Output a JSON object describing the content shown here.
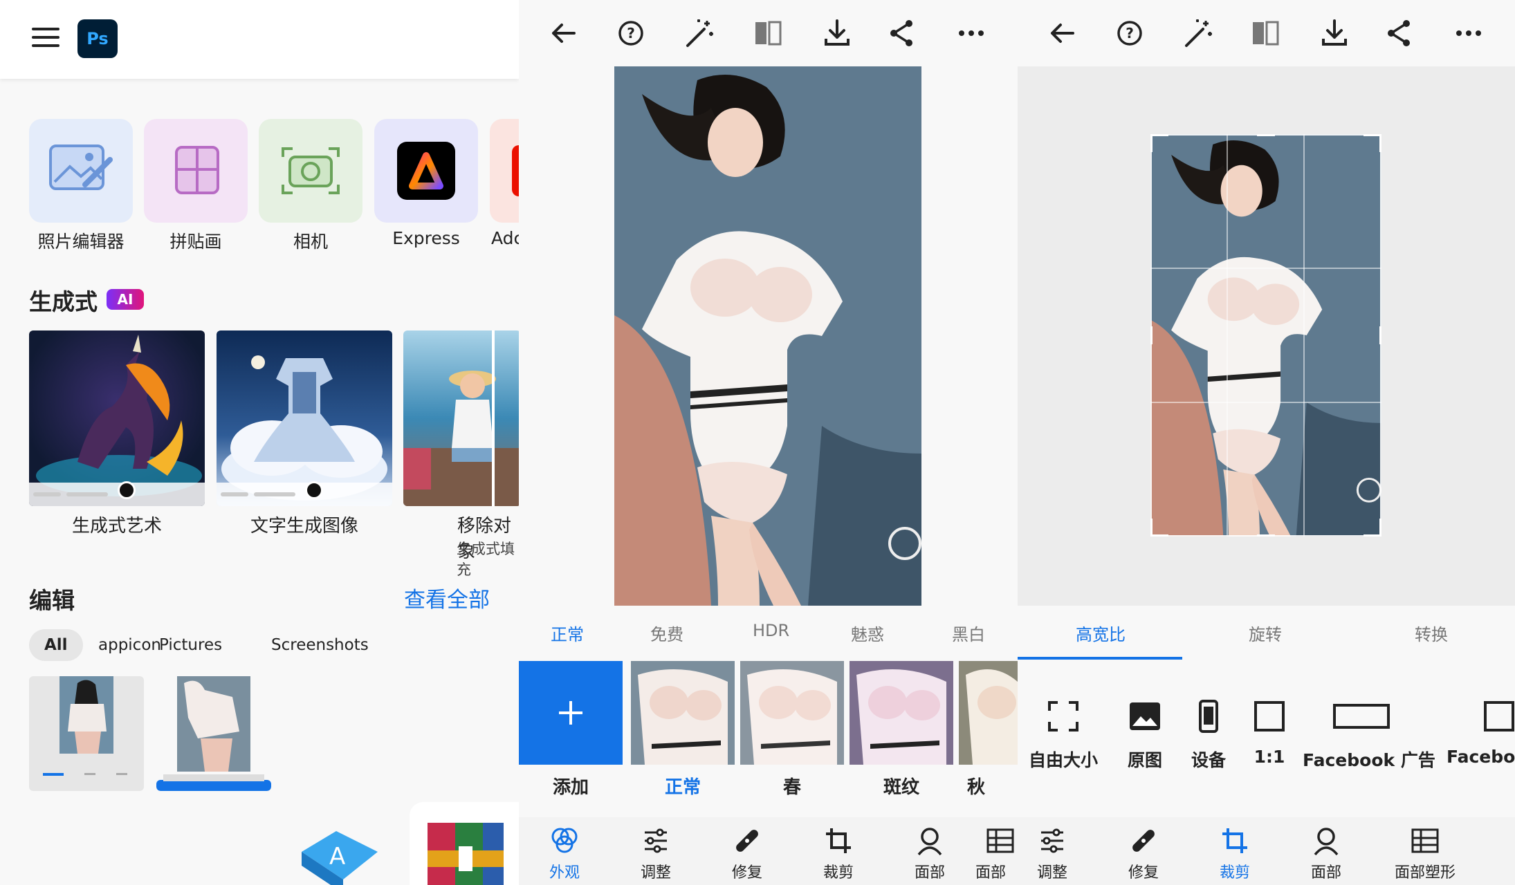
{
  "home": {
    "app_logo": "Ps",
    "tiles": [
      {
        "label": "照片编辑器",
        "icon": "photo-edit-icon"
      },
      {
        "label": "拼贴画",
        "icon": "collage-icon"
      },
      {
        "label": "相机",
        "icon": "camera-icon"
      },
      {
        "label": "Express",
        "icon": "adobe-express-icon"
      },
      {
        "label": "Adc",
        "icon": "adobe-app-icon"
      }
    ],
    "generative_title": "生成式",
    "ai_badge": "AI",
    "generative_cards": [
      {
        "label": "生成式艺术"
      },
      {
        "label": "文字生成图像"
      },
      {
        "label": "移除对象",
        "sublabel": "生成式填充"
      }
    ],
    "edit_title": "编辑",
    "view_all": "查看全部",
    "filters": [
      "All",
      "appicon",
      "Pictures",
      "Screenshots"
    ]
  },
  "editor": {
    "preset_tabs": [
      "正常",
      "免费",
      "HDR",
      "魅惑",
      "黑白"
    ],
    "active_preset_tab": 0,
    "add_label": "添加",
    "presets": [
      "正常",
      "春",
      "斑纹",
      "秋"
    ],
    "active_preset": 0,
    "nav": [
      {
        "label": "外观",
        "icon": "looks-icon"
      },
      {
        "label": "调整",
        "icon": "adjust-icon"
      },
      {
        "label": "修复",
        "icon": "heal-icon"
      },
      {
        "label": "裁剪",
        "icon": "crop-icon"
      },
      {
        "label": "面部",
        "icon": "face-icon"
      },
      {
        "label": "面部",
        "icon": "face-shape-icon"
      }
    ],
    "active_nav": 0
  },
  "crop": {
    "tabs": [
      "高宽比",
      "旋转",
      "转换"
    ],
    "active_tab": 0,
    "ratios": [
      {
        "label": "自由大小",
        "icon": "free-size-icon"
      },
      {
        "label": "原图",
        "icon": "original-icon"
      },
      {
        "label": "设备",
        "icon": "device-icon"
      },
      {
        "label": "1:1",
        "icon": "square-icon"
      },
      {
        "label": "Facebook 广告",
        "icon": "facebook-ad-icon"
      },
      {
        "label": "Faceboo",
        "icon": "facebook-icon"
      }
    ],
    "nav": [
      {
        "label": "调整",
        "icon": "adjust-icon"
      },
      {
        "label": "修复",
        "icon": "heal-icon"
      },
      {
        "label": "裁剪",
        "icon": "crop-icon"
      },
      {
        "label": "面部",
        "icon": "face-icon"
      },
      {
        "label": "面部塑形",
        "icon": "face-shape-icon"
      }
    ],
    "active_nav": 2
  },
  "colors": {
    "accent": "#1473e6",
    "ps_bg": "#001e36",
    "ps_text": "#31a8ff"
  }
}
